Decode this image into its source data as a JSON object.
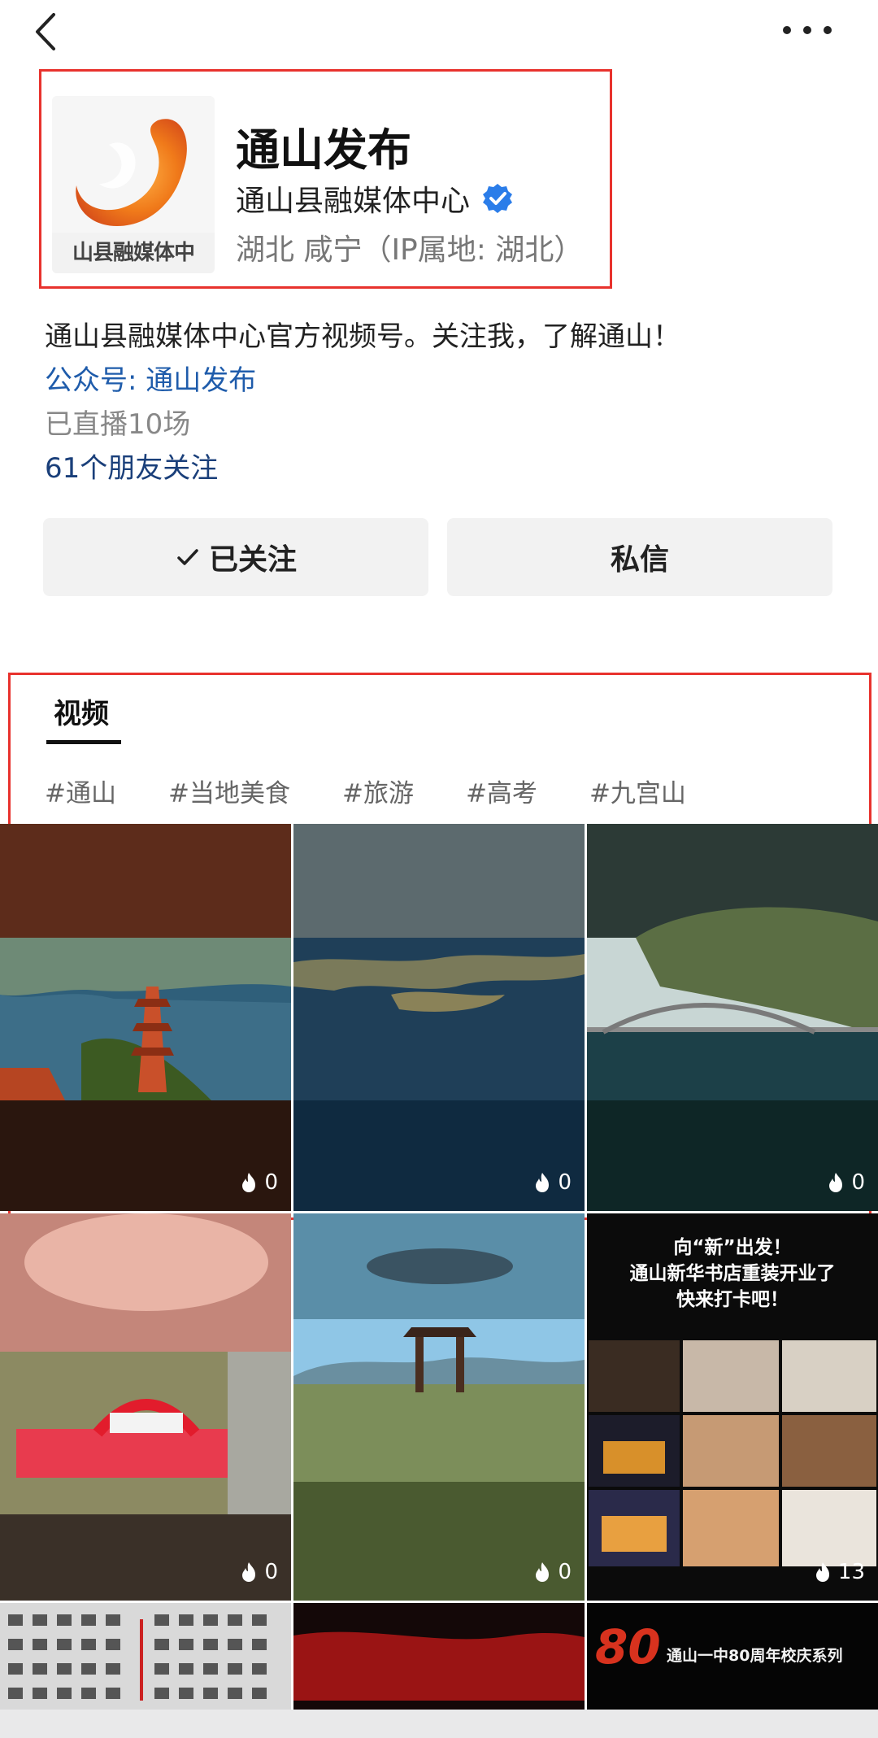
{
  "header": {
    "title": "通山发布",
    "org": "通山县融媒体中心",
    "location": "湖北 咸宁（IP属地: 湖北）"
  },
  "logo": {
    "caption": "山县融媒体中"
  },
  "profile": {
    "bio": "通山县融媒体中心官方视频号。关注我，了解通山！",
    "official_account": "公众号: 通山发布",
    "live_count": "已直播10场",
    "friends_following": "61个朋友关注"
  },
  "actions": {
    "followed_label": "已关注",
    "message_label": "私信"
  },
  "tabs": {
    "videos": "视频"
  },
  "tags": [
    "#通山",
    "#当地美食",
    "#旅游",
    "#高考",
    "#九宫山"
  ],
  "videos": [
    {
      "heat": "0"
    },
    {
      "heat": "0"
    },
    {
      "heat": "0"
    },
    {
      "heat": "0"
    },
    {
      "heat": "0"
    },
    {
      "heat": "13"
    }
  ],
  "video_texts": {
    "bookstore_line1": "向“新”出发！",
    "bookstore_line2": "通山新华书店重装开业了",
    "bookstore_line3": "快来打卡吧！",
    "anniversary": "通山一中80周年校庆系列",
    "anniversary_badge": "80"
  },
  "colors": {
    "accent_red": "#e8322d",
    "link_blue": "#1f5cab",
    "verified_blue": "#2b7de9"
  }
}
